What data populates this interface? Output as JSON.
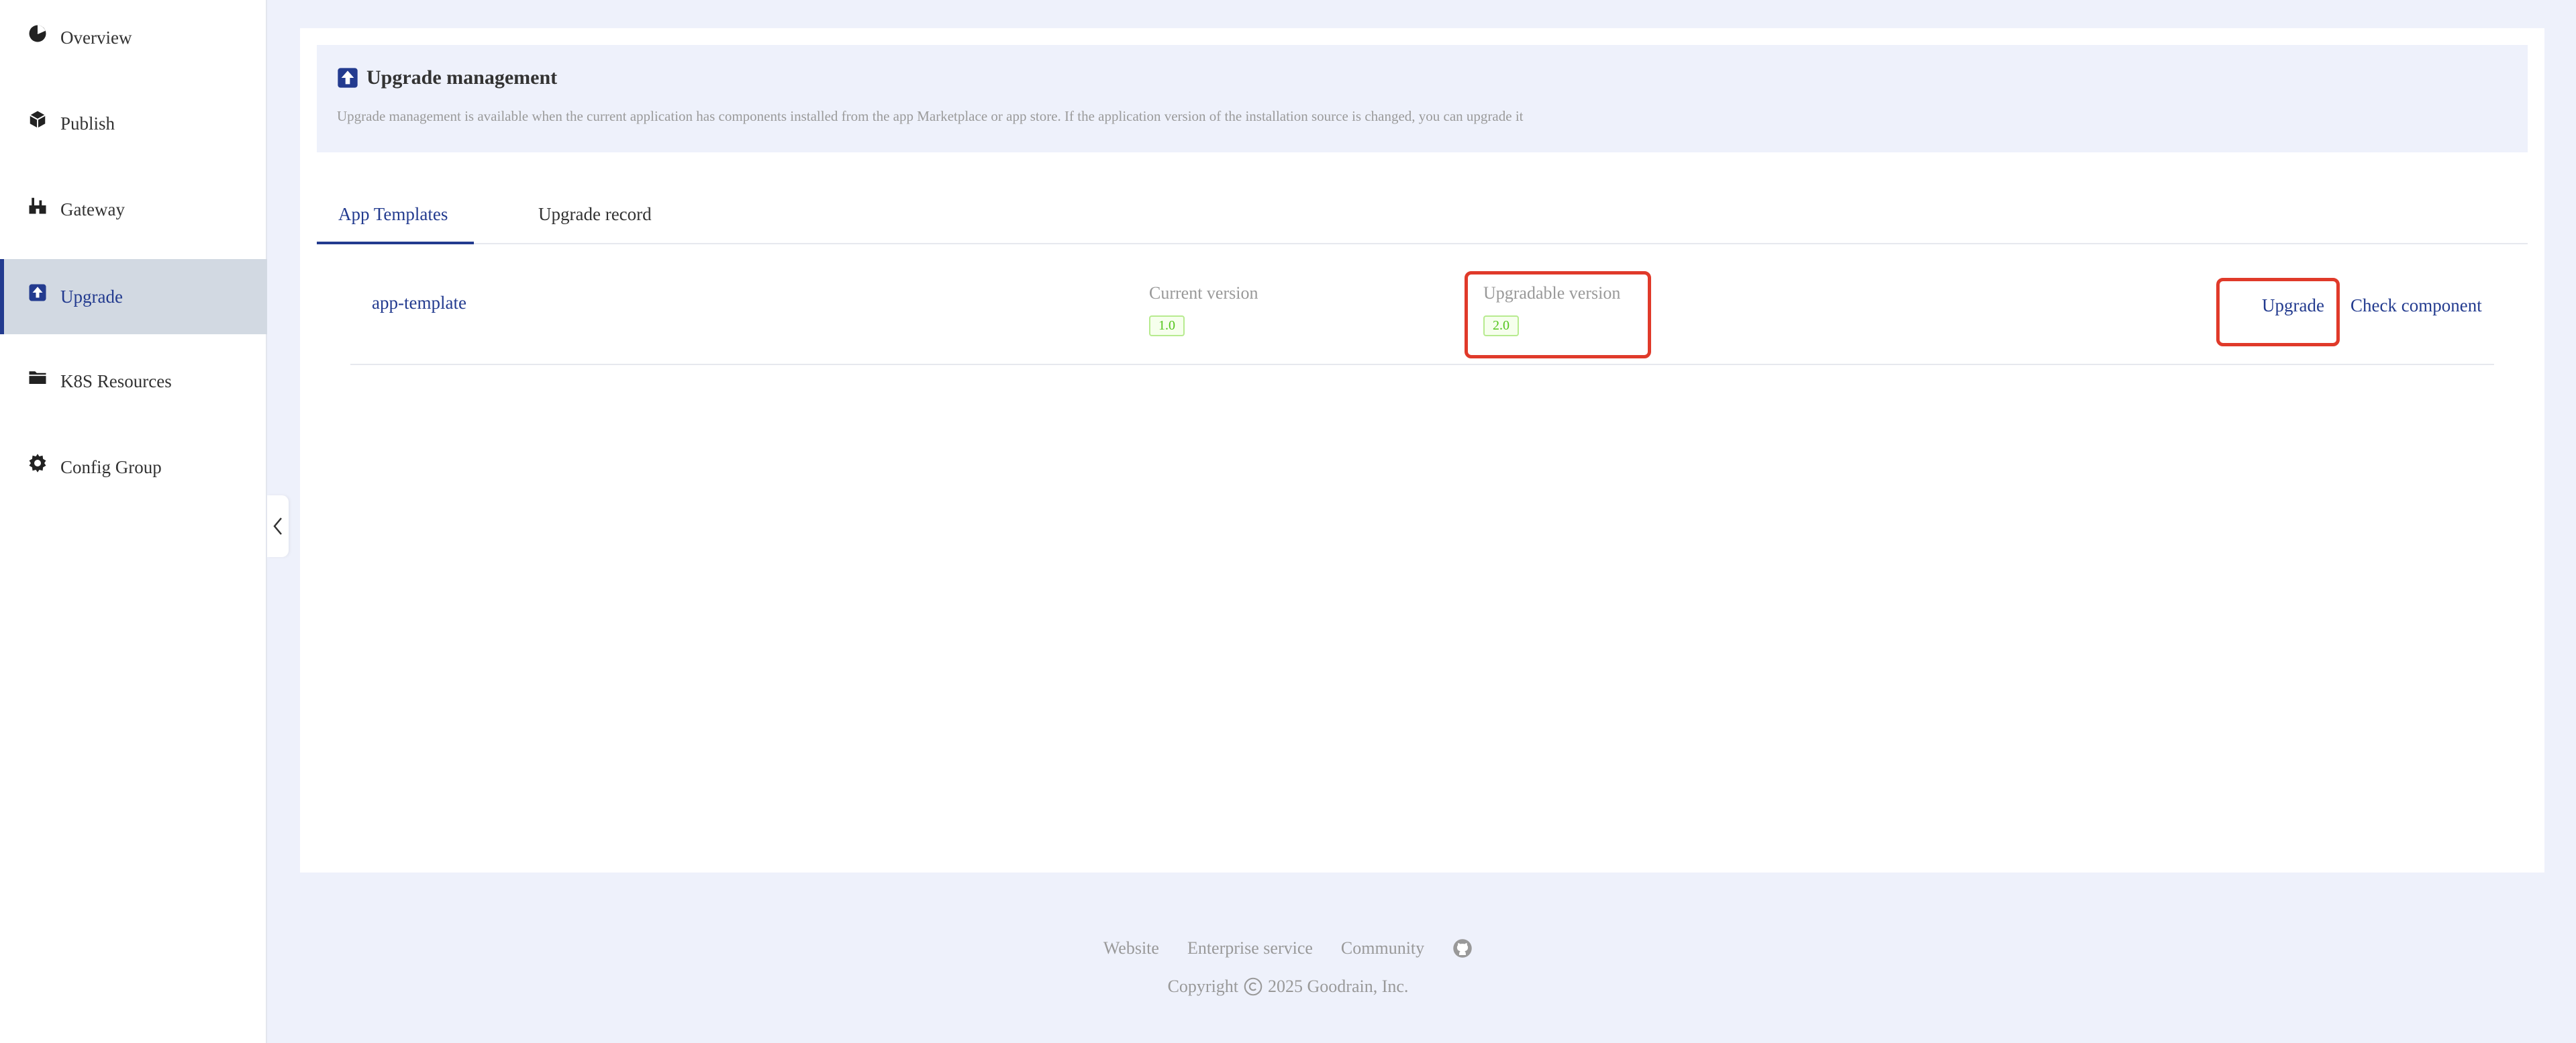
{
  "sidebar": {
    "items": [
      {
        "label": "Overview",
        "icon": "pie-chart-icon"
      },
      {
        "label": "Publish",
        "icon": "cube-icon"
      },
      {
        "label": "Gateway",
        "icon": "gateway-icon"
      },
      {
        "label": "Upgrade",
        "icon": "upgrade-icon"
      },
      {
        "label": "K8S Resources",
        "icon": "folder-icon"
      },
      {
        "label": "Config Group",
        "icon": "gear-icon"
      }
    ],
    "active": "Upgrade"
  },
  "header": {
    "title": "Upgrade management",
    "description": "Upgrade management is available when the current application has components installed from the app Marketplace or app store. If the application version of the installation source is changed, you can upgrade it"
  },
  "tabs": [
    {
      "label": "App Templates",
      "active": true
    },
    {
      "label": "Upgrade record",
      "active": false
    }
  ],
  "rows": [
    {
      "name": "app-template",
      "current_label": "Current version",
      "current_version": "1.0",
      "upgradable_label": "Upgradable version",
      "upgradable_version": "2.0",
      "actions": [
        "Upgrade",
        "Check component"
      ]
    }
  ],
  "footer": {
    "links": [
      "Website",
      "Enterprise service",
      "Community"
    ],
    "copyright_prefix": "Copyright",
    "copyright_suffix": "2025 Goodrain, Inc."
  },
  "colors": {
    "accent": "#233b8f",
    "highlight": "#e03a2a",
    "tag_green": "#52c41a"
  }
}
